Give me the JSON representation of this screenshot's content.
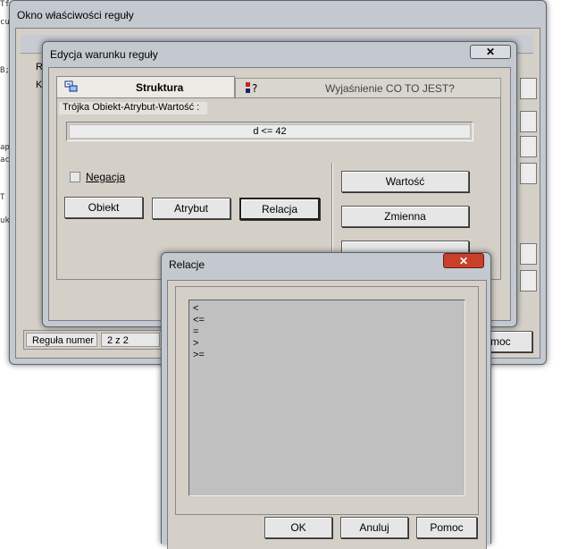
{
  "background_editor": {
    "frag_1": "Tf",
    "frag_2": "cu",
    "frag_3": "B;",
    "frag_4": "ap",
    "frag_5": "ac",
    "frag_6": "T",
    "frag_7": "uk"
  },
  "outer_window": {
    "title": "Okno właściwości reguły",
    "frag_re": "Re",
    "frag_ko": "Ko",
    "status_label": "Reguła numer",
    "status_value": "2 z 2",
    "help_button_partial": "moc"
  },
  "condition_dialog": {
    "title": "Edycja warunku reguły",
    "tabs": [
      {
        "label": "Struktura",
        "active": true
      },
      {
        "label": "Wyjaśnienie CO TO JEST?",
        "active": false
      }
    ],
    "triple_label": "Trójka Obiekt-Atrybut-Wartość :",
    "triple_value": "d <= 42",
    "negation_label": "Negacja",
    "negation_checked": false,
    "buttons": {
      "object": "Obiekt",
      "attribute": "Atrybut",
      "relation": "Relacja",
      "value": "Wartość",
      "variable": "Zmienna"
    }
  },
  "relation_dialog": {
    "title": "Relacje",
    "items": [
      "<",
      "<=",
      "=",
      ">",
      ">="
    ],
    "buttons": {
      "ok": "OK",
      "cancel": "Anuluj",
      "help": "Pomoc"
    }
  },
  "colors": {
    "frame": "#c4c9d0",
    "client": "#d4d0c8",
    "close_red": "#c8402c",
    "list_bg": "#c0c0c0"
  }
}
